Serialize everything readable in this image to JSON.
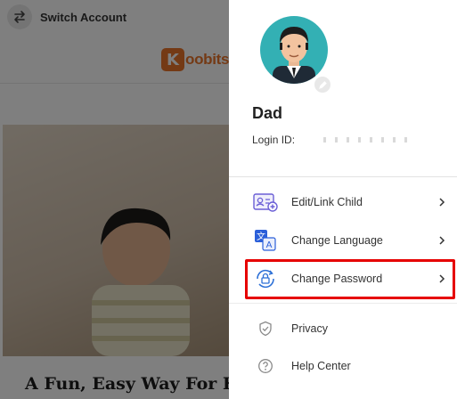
{
  "background": {
    "switch_account_label": "Switch Account",
    "logo_text": "oobits",
    "logo_letter": "K",
    "hero_caption": "A Fun, Easy Way For Ki"
  },
  "profile": {
    "name": "Dad",
    "login_id_label": "Login ID:"
  },
  "menu": {
    "items": [
      {
        "label": "Edit/Link Child",
        "icon": "child-link-icon"
      },
      {
        "label": "Change Language",
        "icon": "translate-icon"
      },
      {
        "label": "Change Password",
        "icon": "password-lock-icon"
      },
      {
        "label": "Privacy",
        "icon": "shield-check-icon"
      },
      {
        "label": "Help Center",
        "icon": "question-circle-icon"
      }
    ],
    "highlighted_item": "Change Password"
  },
  "colors": {
    "accent": "#e8742a",
    "avatar_bg": "#33b0b4",
    "highlight_border": "#e60000",
    "icon_purple": "#6b5fd6"
  }
}
